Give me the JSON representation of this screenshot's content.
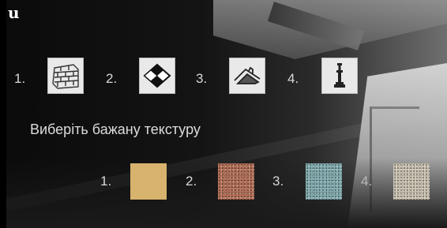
{
  "app": {
    "logo_text": "u"
  },
  "categories": [
    {
      "number": "1.",
      "icon": "brick-wall-icon",
      "button_name": "wall-category-button"
    },
    {
      "number": "2.",
      "icon": "floor-tiles-icon",
      "button_name": "floor-category-button"
    },
    {
      "number": "3.",
      "icon": "roof-icon",
      "button_name": "roof-category-button"
    },
    {
      "number": "4.",
      "icon": "column-icon",
      "button_name": "column-category-button"
    }
  ],
  "prompt_text": "Виберіть бажану текстуру",
  "textures": [
    {
      "number": "1.",
      "color": "#d8b36e",
      "pattern": "solid-sand"
    },
    {
      "number": "2.",
      "color": "#b9735a",
      "pattern": "speckled-terracotta"
    },
    {
      "number": "3.",
      "color": "#86b1b4",
      "pattern": "speckled-teal"
    },
    {
      "number": "4.",
      "color": "#cfc7b6",
      "pattern": "speckled-granite"
    }
  ]
}
